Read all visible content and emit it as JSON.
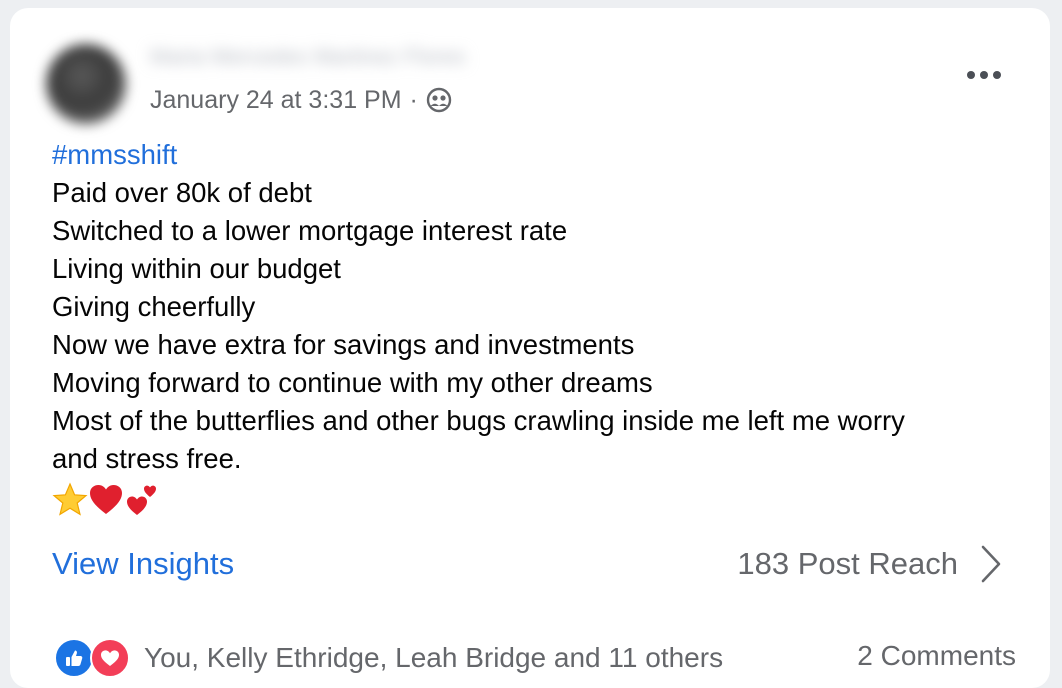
{
  "post": {
    "author_name": "Maria Mercedes Martinez Flores",
    "timestamp": "January 24 at 3:31 PM",
    "separator": "·",
    "audience_icon": "friends-icon",
    "more_icon": "more-horizontal-icon",
    "hashtag": "#mmsshift",
    "lines": [
      "Paid over 80k of debt",
      "Switched to a lower mortgage interest rate",
      "Living within our budget",
      "Giving cheerfully",
      "Now we have extra for savings and investments",
      "Moving forward to continue with my other dreams",
      "Most of the butterflies and other bugs crawling inside me left me worry",
      "and stress free."
    ],
    "emojis": [
      "star-emoji",
      "red-heart-emoji",
      "two-hearts-emoji"
    ]
  },
  "insights": {
    "view_label": "View Insights",
    "reach_label": "183 Post Reach",
    "reach_icon": "chevron-right-icon"
  },
  "footer": {
    "reaction_icons": [
      "like-icon",
      "love-icon"
    ],
    "reactions_text": "You, Kelly Ethridge, Leah Bridge and 11 others",
    "comments_text": "2 Comments"
  },
  "colors": {
    "link_blue": "#216fdb",
    "secondary_text": "#65676b",
    "like_blue": "#1b74e4",
    "love_red": "#f33e58"
  }
}
